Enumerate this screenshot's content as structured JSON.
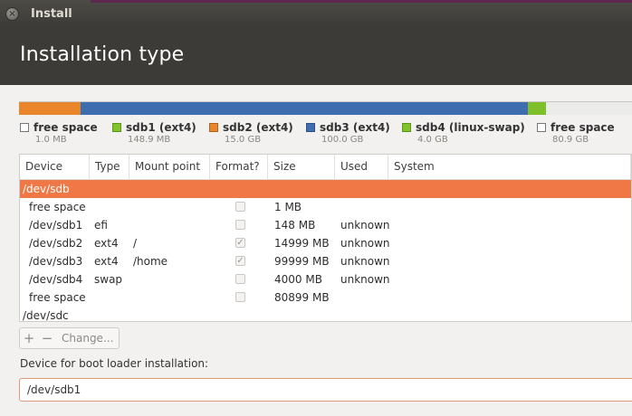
{
  "window": {
    "title": "Install"
  },
  "header": {
    "title": "Installation type"
  },
  "partition_bar": {
    "segments": [
      {
        "name": "sdb2",
        "color": "#e9862a",
        "share": 0.1
      },
      {
        "name": "sdb3",
        "color": "#3e6eb0",
        "share": 0.73
      },
      {
        "name": "sdb4",
        "color": "#7fbf29",
        "share": 0.03
      },
      {
        "name": "free",
        "color": "#ebebea",
        "share": 0.14
      }
    ]
  },
  "legend": [
    {
      "name": "free space",
      "size": "1.0 MB",
      "color": "#ffffff",
      "empty": true
    },
    {
      "name": "sdb1 (ext4)",
      "size": "148.9 MB",
      "color": "#7fc42b",
      "empty": false
    },
    {
      "name": "sdb2 (ext4)",
      "size": "15.0 GB",
      "color": "#e9862a",
      "empty": false
    },
    {
      "name": "sdb3 (ext4)",
      "size": "100.0 GB",
      "color": "#3e6eb0",
      "empty": false
    },
    {
      "name": "sdb4 (linux-swap)",
      "size": "4.0 GB",
      "color": "#7fc42b",
      "empty": false
    },
    {
      "name": "free space",
      "size": "80.9 GB",
      "color": "#ffffff",
      "empty": true
    }
  ],
  "table": {
    "columns": [
      "Device",
      "Type",
      "Mount point",
      "Format?",
      "Size",
      "Used",
      "System"
    ],
    "rows": [
      {
        "device": "/dev/sdb",
        "type": "",
        "mount": "",
        "format": null,
        "size": "",
        "used": "",
        "system": "",
        "kind": "disk",
        "selected": true
      },
      {
        "device": "free space",
        "type": "",
        "mount": "",
        "format": false,
        "size": "1 MB",
        "used": "",
        "system": "",
        "kind": "part",
        "selected": false
      },
      {
        "device": "/dev/sdb1",
        "type": "efi",
        "mount": "",
        "format": false,
        "size": "148 MB",
        "used": "unknown",
        "system": "",
        "kind": "part",
        "selected": false
      },
      {
        "device": "/dev/sdb2",
        "type": "ext4",
        "mount": "/",
        "format": true,
        "size": "14999 MB",
        "used": "unknown",
        "system": "",
        "kind": "part",
        "selected": false
      },
      {
        "device": "/dev/sdb3",
        "type": "ext4",
        "mount": "/home",
        "format": true,
        "size": "99999 MB",
        "used": "unknown",
        "system": "",
        "kind": "part",
        "selected": false
      },
      {
        "device": "/dev/sdb4",
        "type": "swap",
        "mount": "",
        "format": false,
        "size": "4000 MB",
        "used": "unknown",
        "system": "",
        "kind": "part",
        "selected": false
      },
      {
        "device": "free space",
        "type": "",
        "mount": "",
        "format": false,
        "size": "80899 MB",
        "used": "",
        "system": "",
        "kind": "part",
        "selected": false
      },
      {
        "device": "/dev/sdc",
        "type": "",
        "mount": "",
        "format": null,
        "size": "",
        "used": "",
        "system": "",
        "kind": "disk",
        "selected": false
      }
    ]
  },
  "tools": {
    "add": "+",
    "remove": "−",
    "change": "Change..."
  },
  "boot_loader": {
    "label": "Device for boot loader installation:",
    "value": "/dev/sdb1"
  }
}
